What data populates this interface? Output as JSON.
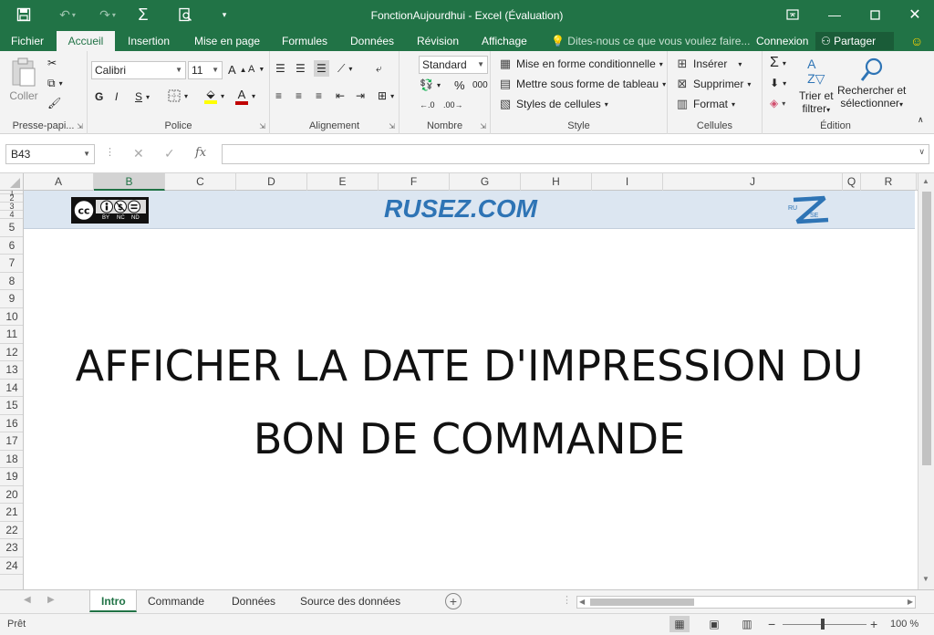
{
  "window": {
    "title": "FonctionAujourdhui - Excel (Évaluation)",
    "colors": {
      "brand": "#217346",
      "banner_bg": "#dce6f1",
      "banner_text": "#2e74b5"
    }
  },
  "tabs": [
    {
      "label": "Fichier"
    },
    {
      "label": "Accueil"
    },
    {
      "label": "Insertion"
    },
    {
      "label": "Mise en page"
    },
    {
      "label": "Formules"
    },
    {
      "label": "Données"
    },
    {
      "label": "Révision"
    },
    {
      "label": "Affichage"
    }
  ],
  "tellme": "Dites-nous ce que vous voulez faire...",
  "account": {
    "signin": "Connexion",
    "share": "Partager"
  },
  "ribbon": {
    "clipboard": {
      "label": "Presse-papi...",
      "paste": "Coller"
    },
    "font": {
      "label": "Police",
      "name": "Calibri",
      "size": "11",
      "bold": "G",
      "italic": "I",
      "underline": "S"
    },
    "alignment": {
      "label": "Alignement"
    },
    "number": {
      "label": "Nombre",
      "format": "Standard",
      "percent": "%",
      "thousands": "000"
    },
    "styles": {
      "label": "Style",
      "conditional": "Mise en forme conditionnelle",
      "table": "Mettre sous forme de tableau",
      "cell_styles": "Styles de cellules"
    },
    "cells": {
      "label": "Cellules",
      "insert": "Insérer",
      "delete": "Supprimer",
      "format": "Format"
    },
    "editing": {
      "label": "Édition",
      "sort_l1": "Trier et",
      "sort_l2": "filtrer",
      "find_l1": "Rechercher et",
      "find_l2": "sélectionner"
    }
  },
  "formula": {
    "name_box": "B43",
    "fx": "fx",
    "value": ""
  },
  "grid": {
    "columns": [
      "A",
      "B",
      "C",
      "D",
      "E",
      "F",
      "G",
      "H",
      "I",
      "J",
      "Q",
      "R"
    ],
    "selected_column": "B",
    "rows": [
      "1",
      "2",
      "3",
      "4",
      "5",
      "6",
      "7",
      "8",
      "9",
      "10",
      "11",
      "12",
      "13",
      "14",
      "15",
      "16",
      "17",
      "18",
      "19",
      "20",
      "21",
      "22",
      "23",
      "24"
    ],
    "banner_text": "RUSEZ.COM",
    "cc_labels": {
      "by": "BY",
      "nc": "NC",
      "nd": "ND"
    },
    "z_logo": {
      "ru": "RU",
      "se": "SE"
    },
    "headline": [
      "AFFICHER LA DATE D'IMPRESSION DU",
      "BON DE COMMANDE"
    ]
  },
  "sheets": [
    {
      "label": "Intro",
      "active": true
    },
    {
      "label": "Commande"
    },
    {
      "label": "Données"
    },
    {
      "label": "Source des données"
    }
  ],
  "status": {
    "ready": "Prêt",
    "zoom": "100 %"
  }
}
